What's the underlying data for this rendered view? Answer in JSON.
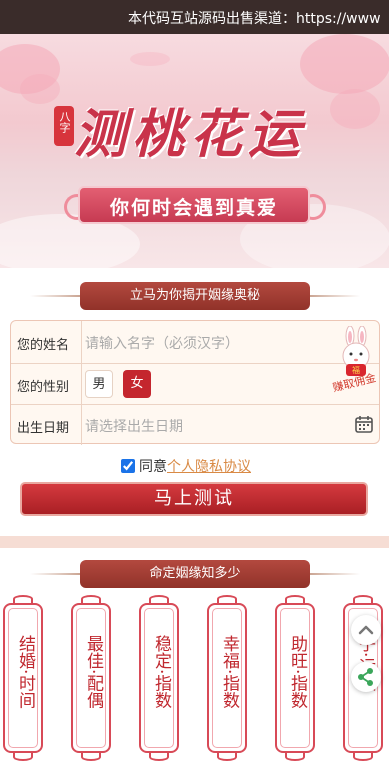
{
  "ticker": {
    "text": "本代码互站源码出售渠道：https://www"
  },
  "banner": {
    "badge": "八字",
    "title": "测桃花运",
    "subtitle": "你何时会遇到真爱"
  },
  "form_section": {
    "heading": "立马为你揭开姻缘奥秘"
  },
  "form": {
    "name_label": "您的姓名",
    "name_placeholder": "请输入名字（必须汉字）",
    "gender_label": "您的性别",
    "gender_male": "男",
    "gender_female": "女",
    "gender_selected": "女",
    "birth_label": "出生日期",
    "birth_placeholder": "请选择出生日期",
    "promo_text": "赚取佣金"
  },
  "agreement": {
    "prefix": "同意",
    "link": "个人隐私协议",
    "checked": true
  },
  "submit_label": "马上测试",
  "cards_section": {
    "heading": "命定姻缘知多少"
  },
  "cards": [
    {
      "text": "结婚·时间"
    },
    {
      "text": "最佳·配偶"
    },
    {
      "text": "稳定·指数"
    },
    {
      "text": "幸福·指数"
    },
    {
      "text": "助旺·指数"
    },
    {
      "text": "子·运数"
    }
  ],
  "colors": {
    "accent": "#c4262e",
    "brown": "#a13c32",
    "pink": "#d84a57"
  },
  "icons": {
    "calendar": "calendar-icon",
    "scroll_top": "chevron-up-icon",
    "share": "share-icon"
  }
}
